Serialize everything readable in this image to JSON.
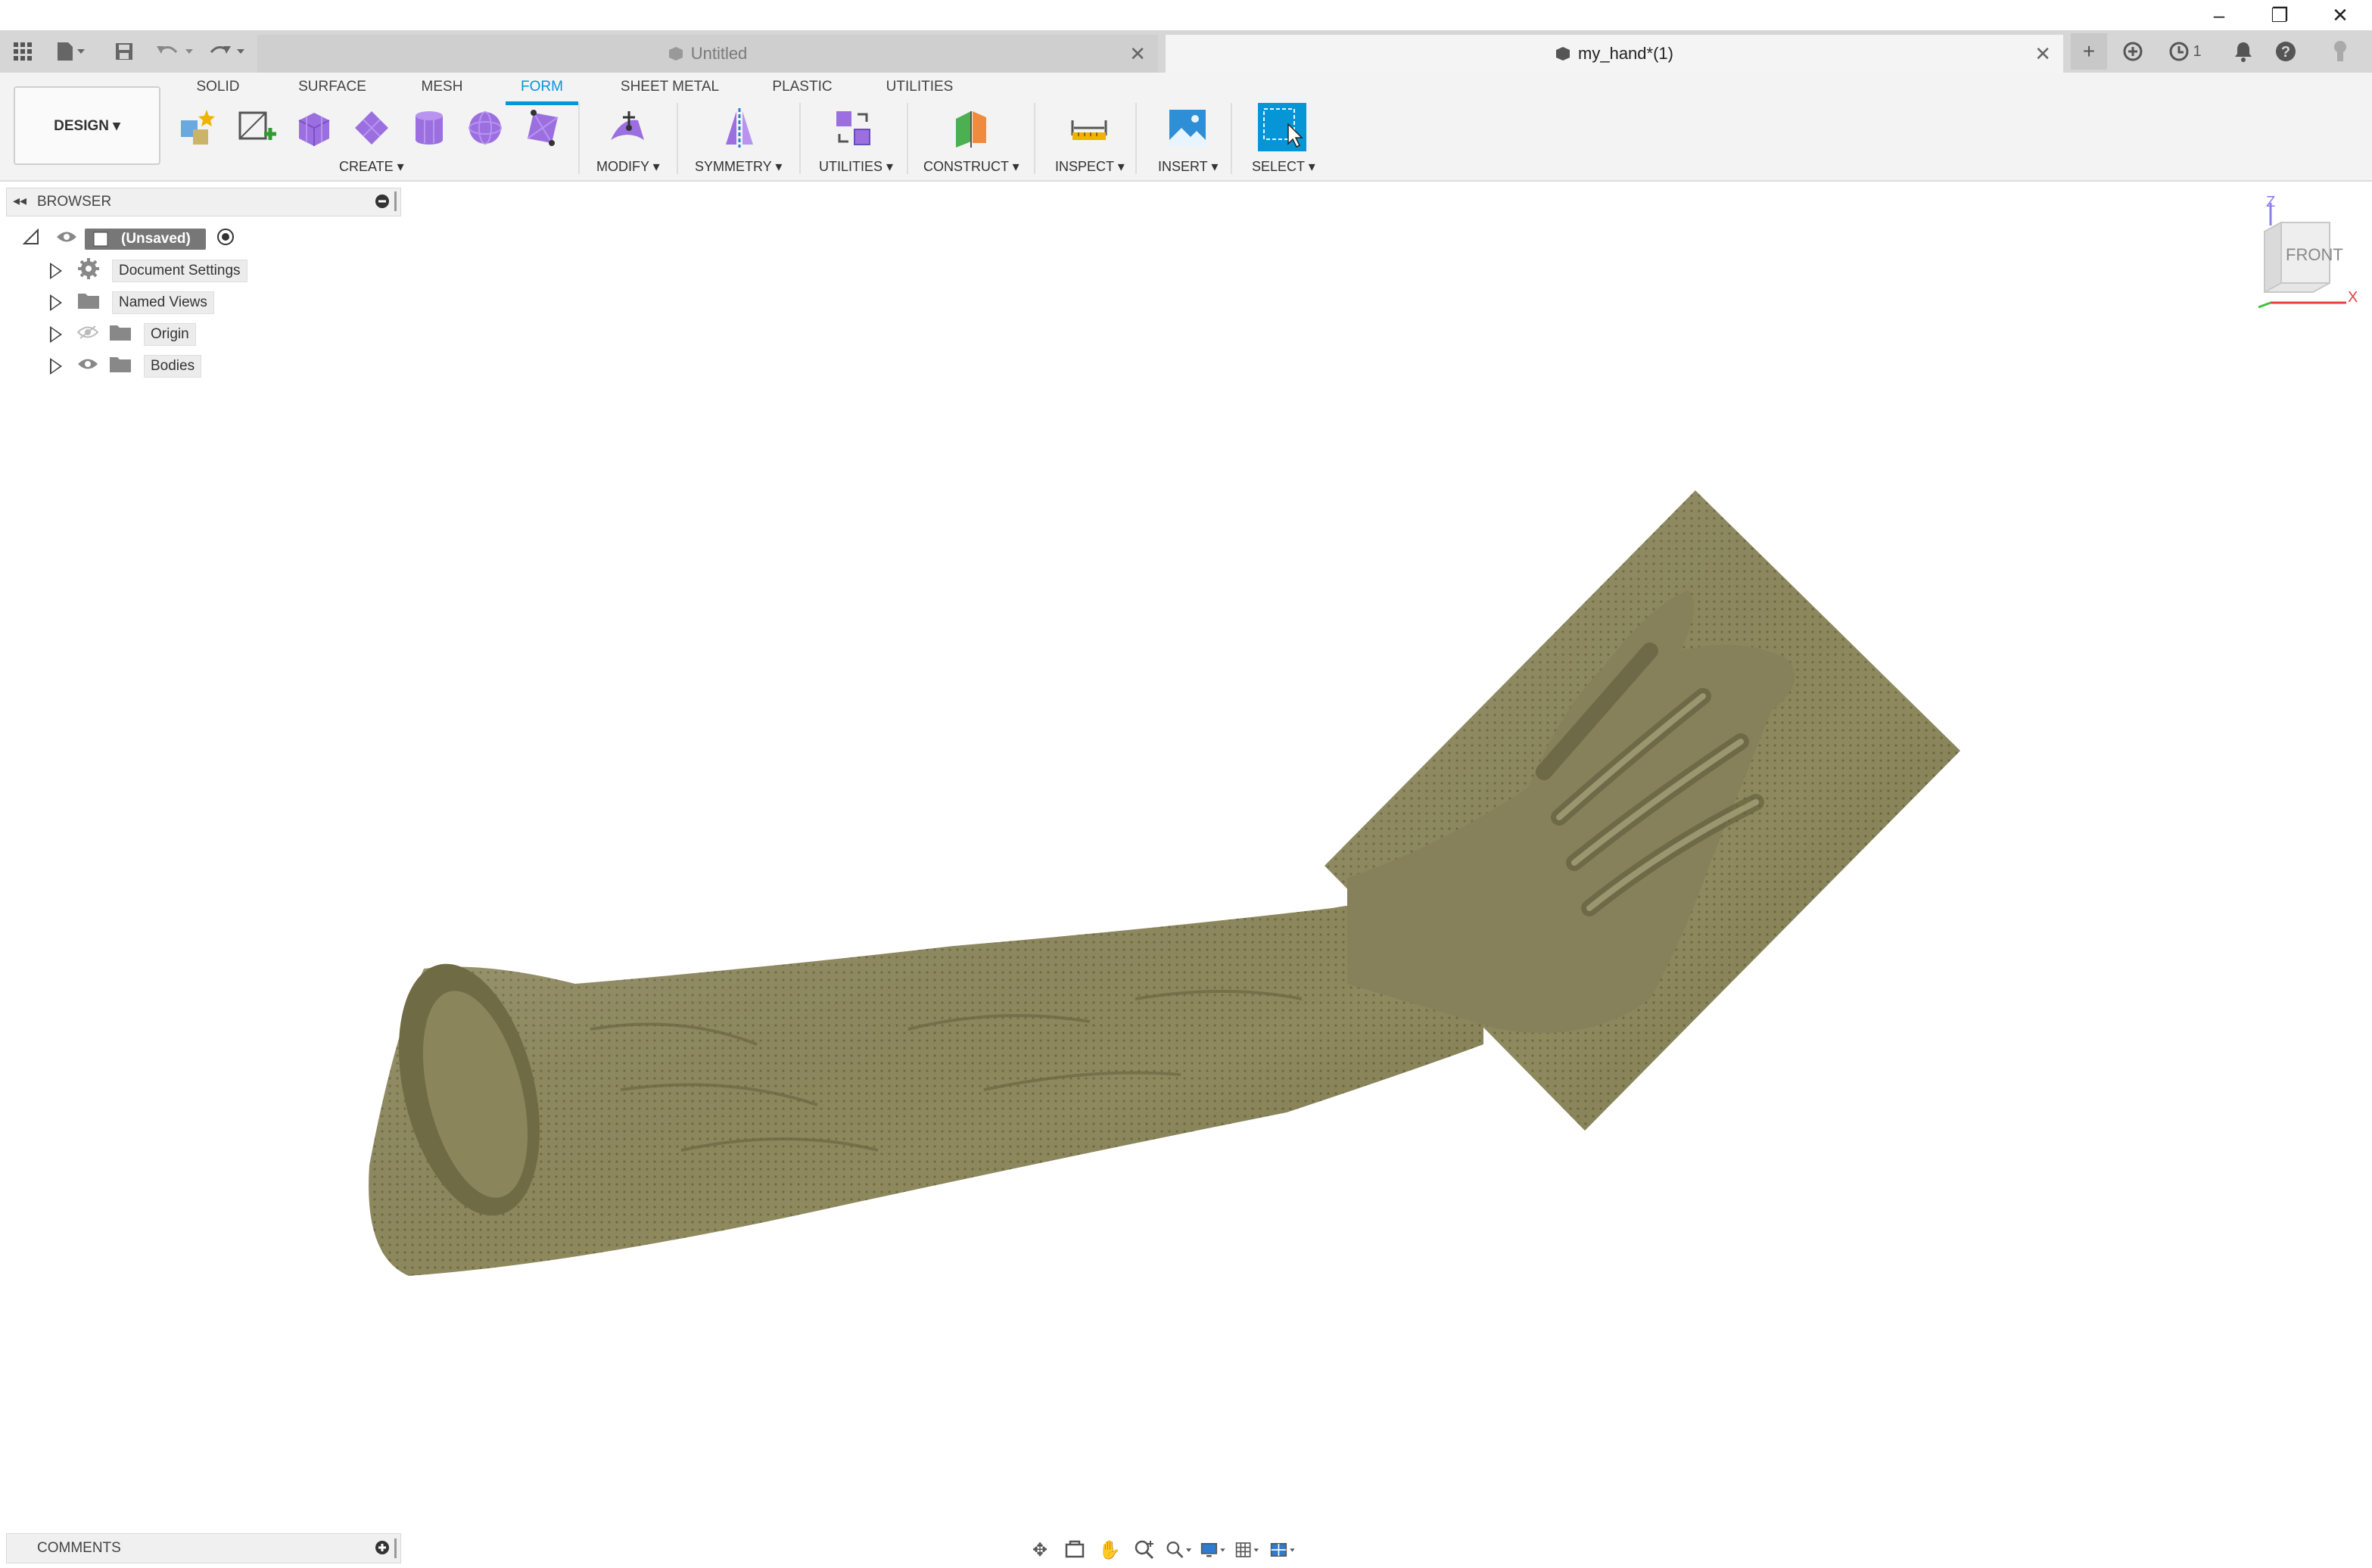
{
  "window": {
    "controls": {
      "minimize": "–",
      "restore": "❐",
      "close": "✕"
    }
  },
  "tabs": {
    "untitled": {
      "label": "Untitled",
      "close": "✕"
    },
    "active": {
      "label": "my_hand*(1)",
      "close": "✕"
    },
    "right_icons": {
      "new_tab": "+",
      "jobs_count": "1"
    }
  },
  "toolbar": {
    "workspace": "DESIGN ▾",
    "workspace_tabs": [
      "SOLID",
      "SURFACE",
      "MESH",
      "FORM",
      "SHEET METAL",
      "PLASTIC",
      "UTILITIES"
    ],
    "active_tab": "FORM",
    "groups": {
      "create": "CREATE ▾",
      "modify": "MODIFY ▾",
      "symmetry": "SYMMETRY ▾",
      "utilities": "UTILITIES ▾",
      "construct": "CONSTRUCT ▾",
      "inspect": "INSPECT ▾",
      "insert": "INSERT ▾",
      "select": "SELECT ▾"
    },
    "colors": {
      "accent": "#0696d7",
      "form_tool": "#9b6fe0"
    }
  },
  "browser": {
    "title": "BROWSER",
    "root": "(Unsaved)",
    "items": [
      "Document Settings",
      "Named Views",
      "Origin",
      "Bodies"
    ]
  },
  "viewcube": {
    "face": "FRONT",
    "axis_z": "Z",
    "axis_x": "X"
  },
  "comments": {
    "title": "COMMENTS"
  },
  "model": {
    "name": "my_hand",
    "color": "#8f8a5e"
  }
}
